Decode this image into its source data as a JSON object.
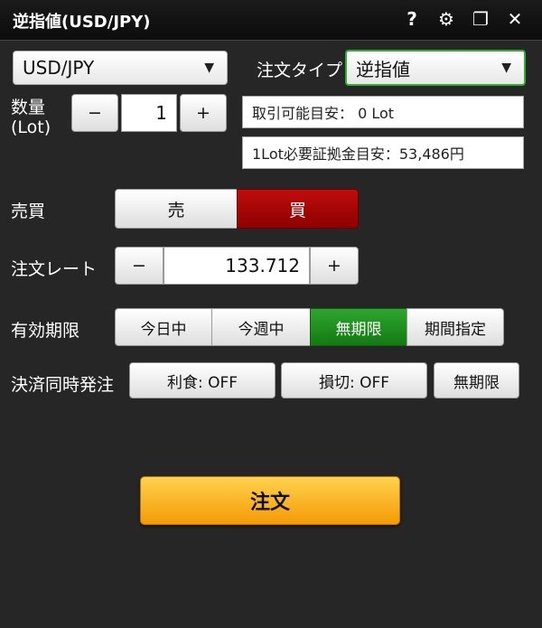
{
  "titlebar": {
    "title": "逆指値(USD/JPY)",
    "icons": [
      {
        "name": "help-icon",
        "glyph": "?"
      },
      {
        "name": "gear-icon",
        "glyph": "⚙"
      },
      {
        "name": "restore-window-icon",
        "glyph": "❐"
      },
      {
        "name": "close-icon",
        "glyph": "✕"
      }
    ]
  },
  "pair_select": {
    "value": "USD/JPY",
    "arrow": "▼"
  },
  "order_type": {
    "label": "注文タイプ",
    "value": "逆指値",
    "arrow": "▼"
  },
  "quantity": {
    "label_line1": "数量",
    "label_line2": "(Lot)",
    "minus": "−",
    "value": "1",
    "plus": "+"
  },
  "info": {
    "tradable": "取引可能目安：  0 Lot",
    "margin": "1Lot必要証拠金目安：53,486円"
  },
  "side": {
    "label": "売買",
    "sell": "売",
    "buy": "買",
    "selected": "buy"
  },
  "rate": {
    "label": "注文レート",
    "minus": "−",
    "value": "133.712",
    "plus": "+"
  },
  "expiry": {
    "label": "有効期限",
    "options": [
      "今日中",
      "今週中",
      "無期限",
      "期間指定"
    ],
    "selected": "無期限"
  },
  "settlement": {
    "label": "決済同時発注",
    "take_profit": "利食: OFF",
    "stop_loss": "損切: OFF",
    "expiry": "無期限"
  },
  "order_button": "注文",
  "colors": {
    "accent_green": "#2fae2f",
    "buy_red": "#a80505",
    "order_orange": "#f8a81a",
    "background": "#262626"
  }
}
